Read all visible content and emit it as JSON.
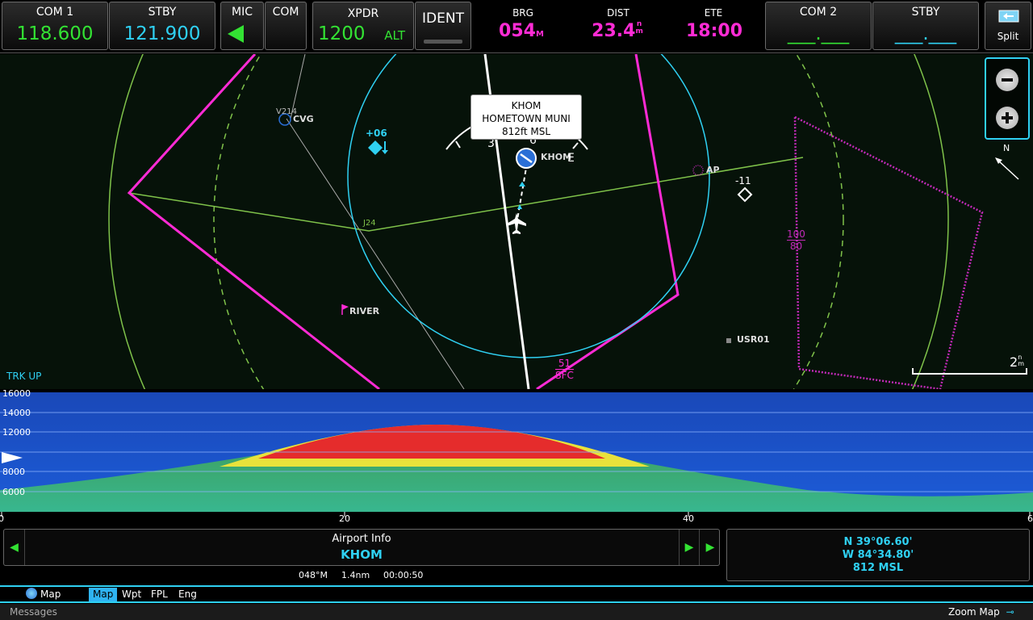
{
  "com1": {
    "label": "COM 1",
    "active": "118.600",
    "stby_label": "STBY",
    "stby": "121.900"
  },
  "audio": {
    "mic_label": "MIC",
    "com_label": "COM"
  },
  "xpdr": {
    "label": "XPDR",
    "code": "1200",
    "mode": "ALT",
    "ident_label": "IDENT"
  },
  "nav": {
    "brg_label": "BRG",
    "brg_value": "054",
    "brg_unit": "M",
    "dist_label": "DIST",
    "dist_value": "23.4",
    "dist_unit_top": "n",
    "dist_unit_bottom": "m",
    "ete_label": "ETE",
    "ete_value": "18:00"
  },
  "com2": {
    "label": "COM 2",
    "active": "___.___",
    "stby_label": "STBY",
    "stby": "___.___"
  },
  "split": {
    "label": "Split"
  },
  "map": {
    "callout": {
      "ident": "KHOM",
      "name": "HOMETOWN MUNI",
      "elevation": "812ft MSL"
    },
    "labels": {
      "cvg": "CVG",
      "v214": "V214",
      "j24": "J24",
      "river": "RIVER",
      "ap": "AP",
      "usr01": "USR01",
      "khom": "KHOM",
      "plus06": "+06",
      "minus11": "-11",
      "sfc_top": "51",
      "sfc_bottom": "SFC",
      "airspace_top": "100",
      "airspace_bottom": "80",
      "trk_up": "TRK UP",
      "north": "N",
      "compass_e": "E",
      "compass_3": "3",
      "compass_6": "6",
      "scale_value": "2",
      "scale_unit_top": "n",
      "scale_unit_bottom": "m"
    }
  },
  "profile": {
    "y_ticks": [
      "16000",
      "14000",
      "12000",
      "8000",
      "6000"
    ],
    "x_ticks": [
      "0",
      "20",
      "40",
      "6"
    ]
  },
  "info": {
    "title": "Airport Info",
    "ident": "KHOM",
    "bearing": "048°M",
    "distance": "1.4nm",
    "time": "00:00:50"
  },
  "coords": {
    "lat": "N 39°06.60'",
    "lon": "W 84°34.80'",
    "elev": "812 MSL"
  },
  "tabs": {
    "map_page": "Map",
    "items": [
      "Map",
      "Wpt",
      "FPL",
      "Eng"
    ]
  },
  "status": {
    "messages": "Messages",
    "zoom": "Zoom Map"
  },
  "colors": {
    "active_freq": "#33e233",
    "standby_freq": "#2fd0f2",
    "flight_plan": "#ff2bd5",
    "accent": "#2fd0f2"
  }
}
